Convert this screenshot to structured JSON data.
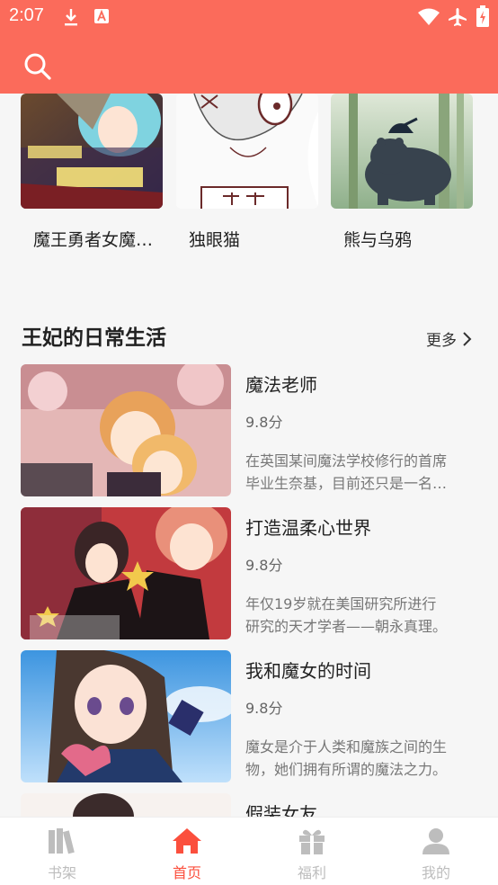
{
  "status_bar": {
    "time": "2:07",
    "icons": [
      "download-icon",
      "apk-icon",
      "wifi-icon",
      "airplane-icon",
      "battery-icon"
    ]
  },
  "header": {
    "search_icon": "search-icon",
    "accent_color": "#fb6b5b"
  },
  "top_row": [
    {
      "title": "魔王勇者女魔法使"
    },
    {
      "title": "独眼猫"
    },
    {
      "title": "熊与乌鸦"
    }
  ],
  "section": {
    "title": "王妃的日常生活",
    "more_label": "更多"
  },
  "list": [
    {
      "name": "魔法老师",
      "score": "9.8分",
      "desc": "在英国某间魔法学校修行的首席毕业生奈基，目前还只是一名十岁的少年。"
    },
    {
      "name": "打造温柔心世界",
      "score": "9.8分",
      "desc": "年仅19岁就在美国研究所进行研究的天才学者——朝永真理。"
    },
    {
      "name": "我和魔女的时间",
      "score": "9.8分",
      "desc": "魔女是介于人类和魔族之间的生物，她们拥有所谓的魔法之力。"
    },
    {
      "name": "假装女友",
      "score": "",
      "desc": ""
    }
  ],
  "nav": [
    {
      "label": "书架",
      "icon": "bookshelf-icon",
      "active": false
    },
    {
      "label": "首页",
      "icon": "home-icon",
      "active": true
    },
    {
      "label": "福利",
      "icon": "gift-icon",
      "active": false
    },
    {
      "label": "我的",
      "icon": "profile-icon",
      "active": false
    }
  ]
}
